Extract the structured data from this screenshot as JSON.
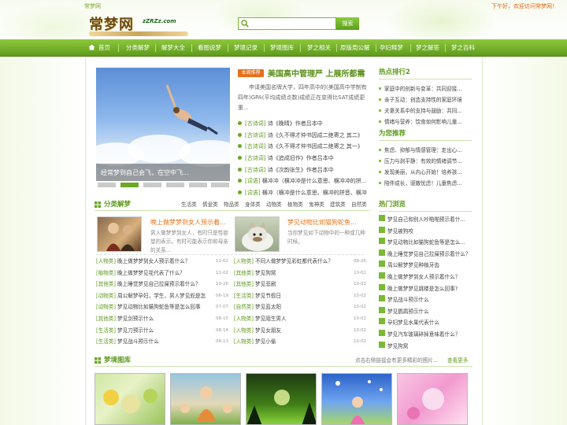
{
  "header": {
    "site_name_small": "常梦网",
    "welcome": "下午好，欢迎访问常梦网！",
    "logo_text": "常梦网",
    "logo_url": "zZRZz.com",
    "search_placeholder": "",
    "search_button": "搜索"
  },
  "nav": {
    "items": [
      {
        "label": "首页"
      },
      {
        "label": "分类解梦"
      },
      {
        "label": "解梦大全"
      },
      {
        "label": "看图说梦"
      },
      {
        "label": "梦境记录"
      },
      {
        "label": "梦境图库"
      },
      {
        "label": "梦之相关"
      },
      {
        "label": "原版周公解"
      },
      {
        "label": "孕妇释梦"
      },
      {
        "label": "梦之解答"
      },
      {
        "label": "梦之百科"
      }
    ]
  },
  "slideshow": {
    "caption": "经常梦到自己会飞，在空中飞..."
  },
  "featured": {
    "tag": "本周推荐",
    "title": "美国高中管理严 上展所都需",
    "summary": "申请美国名牌大学，四年高中的(美国高中学制有四年)GPA(平均成绩点数)成绩正在变得比SAT成绩更重..."
  },
  "news": [
    {
      "cat": "[古诗词]",
      "title": "诗《晚晴》作者吕本中"
    },
    {
      "cat": "[古诗词]",
      "title": "诗《久不得才仲书因成二绝寄之 其二》"
    },
    {
      "cat": "[古诗词]",
      "title": "诗《久不得才仲书因成二绝寄之 其一》"
    },
    {
      "cat": "[古诗词]",
      "title": "诗《追成旧作》作者吕本中"
    },
    {
      "cat": "[古诗词]",
      "title": "诗《次韵张生》作者吕本中"
    },
    {
      "cat": "[词语]",
      "title": "横冲冲（横冲冲是什么意思、横冲冲的拼..."
    },
    {
      "cat": "[词语]",
      "title": "横冲（横冲是什么意思、横冲的拼音、横冲"
    }
  ],
  "hot_ranking": {
    "title": "热点排行2",
    "items": [
      "家庭中的创新与变革：共同迎接...",
      "亲子互动：创造支持性的家庭环境",
      "夫妻关系中的支持与鼓励：共同...",
      "情绪与营养：饮食如何影响儿童..."
    ]
  },
  "recommend": {
    "title": "为您推荐",
    "items": [
      "焦虑、抑郁与情感管理：走出心...",
      "压力与剥平静：有效的情绪调节...",
      "发现美丽，从内心开始！培养孩...",
      "陪伴成长，驱散忧虑！儿童焦虑..."
    ]
  },
  "category_section": {
    "title": "分类解梦",
    "subcats": [
      "生活类",
      "情爱类",
      "物品类",
      "身体类",
      "动物类",
      "植物类",
      "鬼神类",
      "建筑类",
      "自然类"
    ],
    "feature1": {
      "title": "晚上做梦梦到女人预示着...",
      "desc": "男人做梦梦到女人，有时只是性欲望的表示。有时可能表示你和母亲的关系..."
    },
    "feature2": {
      "title": "梦见动物比如猫狗蛇鱼...",
      "desc": "当你梦见如下动物中的一种或几种时候，"
    },
    "list_left": [
      {
        "cat": "[人物类]",
        "title": "晚上做梦梦到女人预示着什么？",
        "date": "11-02"
      },
      {
        "cat": "[植物类]",
        "title": "晚上做梦梦见花代表了什么？",
        "date": "11-02"
      },
      {
        "cat": "[其他类]",
        "title": "晚上睡觉梦见自己拉屎预示着什么？",
        "date": "10-26"
      },
      {
        "cat": "[动物类]",
        "title": "周公解梦孕妇，学生，男人梦见蛇是怎",
        "date": "06-19"
      },
      {
        "cat": "[动物类]",
        "title": "梦见动物比如猫狗蛇鱼等是怎么回事",
        "date": "07-07"
      },
      {
        "cat": "[其他类]",
        "title": "梦见剑预示什么",
        "date": "08-15"
      },
      {
        "cat": "[生活类]",
        "title": "梦见刀预示什么",
        "date": "08-14"
      },
      {
        "cat": "[生活类]",
        "title": "梦见战斗预示什么",
        "date": "08-13"
      }
    ],
    "list_right": [
      {
        "cat": "[人物类]",
        "title": "不同人做梦梦见彩虹都代表什么？",
        "date": "08-26"
      },
      {
        "cat": "[其他类]",
        "title": "梦见狗窝",
        "date": "10-02"
      },
      {
        "cat": "[其他类]",
        "title": "梦见悲剧",
        "date": "10-02"
      },
      {
        "cat": "[生活类]",
        "title": "梦见节假日",
        "date": "10-02"
      },
      {
        "cat": "[自然类]",
        "title": "梦见蓝太阳",
        "date": "10-02"
      },
      {
        "cat": "[人物类]",
        "title": "梦见陌生男人",
        "date": "10-02"
      },
      {
        "cat": "[人物类]",
        "title": "梦见女朋友",
        "date": "10-02"
      },
      {
        "cat": "[人物类]",
        "title": "梦见小偷",
        "date": "10-02"
      }
    ]
  },
  "hot_browse": {
    "title": "热门浏览",
    "items": [
      "梦见自己和别人吵啪啪预示着什...",
      "梦见被狗咬",
      "梦见动物比如猫狗蛇鱼等是怎么...",
      "晚上睡觉梦见自己拉屎预示着什么？",
      "周公解梦梦见种植牙齿",
      "晚上做梦梦到女人预示着什么？",
      "晚上做梦梦见跳楼是怎么回事?",
      "梦见战斗预示什么",
      "梦见鹦鹉预示什么",
      "孕妇梦见水果代表什么",
      "梦见汽车玻璃碎掉意味着什么？",
      "梦见狗窝"
    ]
  },
  "gallery": {
    "title": "梦境图库",
    "note": "点击右侧链接会有更多精彩的图片...",
    "more": "查看更多"
  }
}
